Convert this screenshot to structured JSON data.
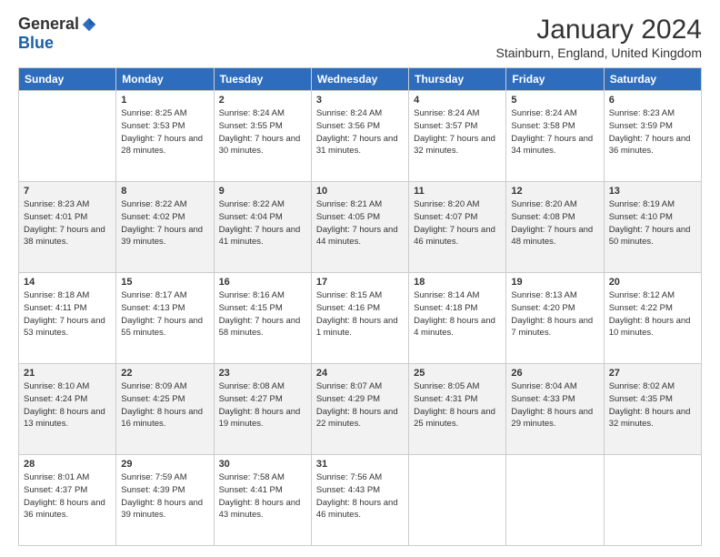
{
  "logo": {
    "general": "General",
    "blue": "Blue"
  },
  "title": "January 2024",
  "subtitle": "Stainburn, England, United Kingdom",
  "header_days": [
    "Sunday",
    "Monday",
    "Tuesday",
    "Wednesday",
    "Thursday",
    "Friday",
    "Saturday"
  ],
  "weeks": [
    [
      {
        "day": "",
        "sunrise": "",
        "sunset": "",
        "daylight": ""
      },
      {
        "day": "1",
        "sunrise": "Sunrise: 8:25 AM",
        "sunset": "Sunset: 3:53 PM",
        "daylight": "Daylight: 7 hours and 28 minutes."
      },
      {
        "day": "2",
        "sunrise": "Sunrise: 8:24 AM",
        "sunset": "Sunset: 3:55 PM",
        "daylight": "Daylight: 7 hours and 30 minutes."
      },
      {
        "day": "3",
        "sunrise": "Sunrise: 8:24 AM",
        "sunset": "Sunset: 3:56 PM",
        "daylight": "Daylight: 7 hours and 31 minutes."
      },
      {
        "day": "4",
        "sunrise": "Sunrise: 8:24 AM",
        "sunset": "Sunset: 3:57 PM",
        "daylight": "Daylight: 7 hours and 32 minutes."
      },
      {
        "day": "5",
        "sunrise": "Sunrise: 8:24 AM",
        "sunset": "Sunset: 3:58 PM",
        "daylight": "Daylight: 7 hours and 34 minutes."
      },
      {
        "day": "6",
        "sunrise": "Sunrise: 8:23 AM",
        "sunset": "Sunset: 3:59 PM",
        "daylight": "Daylight: 7 hours and 36 minutes."
      }
    ],
    [
      {
        "day": "7",
        "sunrise": "Sunrise: 8:23 AM",
        "sunset": "Sunset: 4:01 PM",
        "daylight": "Daylight: 7 hours and 38 minutes."
      },
      {
        "day": "8",
        "sunrise": "Sunrise: 8:22 AM",
        "sunset": "Sunset: 4:02 PM",
        "daylight": "Daylight: 7 hours and 39 minutes."
      },
      {
        "day": "9",
        "sunrise": "Sunrise: 8:22 AM",
        "sunset": "Sunset: 4:04 PM",
        "daylight": "Daylight: 7 hours and 41 minutes."
      },
      {
        "day": "10",
        "sunrise": "Sunrise: 8:21 AM",
        "sunset": "Sunset: 4:05 PM",
        "daylight": "Daylight: 7 hours and 44 minutes."
      },
      {
        "day": "11",
        "sunrise": "Sunrise: 8:20 AM",
        "sunset": "Sunset: 4:07 PM",
        "daylight": "Daylight: 7 hours and 46 minutes."
      },
      {
        "day": "12",
        "sunrise": "Sunrise: 8:20 AM",
        "sunset": "Sunset: 4:08 PM",
        "daylight": "Daylight: 7 hours and 48 minutes."
      },
      {
        "day": "13",
        "sunrise": "Sunrise: 8:19 AM",
        "sunset": "Sunset: 4:10 PM",
        "daylight": "Daylight: 7 hours and 50 minutes."
      }
    ],
    [
      {
        "day": "14",
        "sunrise": "Sunrise: 8:18 AM",
        "sunset": "Sunset: 4:11 PM",
        "daylight": "Daylight: 7 hours and 53 minutes."
      },
      {
        "day": "15",
        "sunrise": "Sunrise: 8:17 AM",
        "sunset": "Sunset: 4:13 PM",
        "daylight": "Daylight: 7 hours and 55 minutes."
      },
      {
        "day": "16",
        "sunrise": "Sunrise: 8:16 AM",
        "sunset": "Sunset: 4:15 PM",
        "daylight": "Daylight: 7 hours and 58 minutes."
      },
      {
        "day": "17",
        "sunrise": "Sunrise: 8:15 AM",
        "sunset": "Sunset: 4:16 PM",
        "daylight": "Daylight: 8 hours and 1 minute."
      },
      {
        "day": "18",
        "sunrise": "Sunrise: 8:14 AM",
        "sunset": "Sunset: 4:18 PM",
        "daylight": "Daylight: 8 hours and 4 minutes."
      },
      {
        "day": "19",
        "sunrise": "Sunrise: 8:13 AM",
        "sunset": "Sunset: 4:20 PM",
        "daylight": "Daylight: 8 hours and 7 minutes."
      },
      {
        "day": "20",
        "sunrise": "Sunrise: 8:12 AM",
        "sunset": "Sunset: 4:22 PM",
        "daylight": "Daylight: 8 hours and 10 minutes."
      }
    ],
    [
      {
        "day": "21",
        "sunrise": "Sunrise: 8:10 AM",
        "sunset": "Sunset: 4:24 PM",
        "daylight": "Daylight: 8 hours and 13 minutes."
      },
      {
        "day": "22",
        "sunrise": "Sunrise: 8:09 AM",
        "sunset": "Sunset: 4:25 PM",
        "daylight": "Daylight: 8 hours and 16 minutes."
      },
      {
        "day": "23",
        "sunrise": "Sunrise: 8:08 AM",
        "sunset": "Sunset: 4:27 PM",
        "daylight": "Daylight: 8 hours and 19 minutes."
      },
      {
        "day": "24",
        "sunrise": "Sunrise: 8:07 AM",
        "sunset": "Sunset: 4:29 PM",
        "daylight": "Daylight: 8 hours and 22 minutes."
      },
      {
        "day": "25",
        "sunrise": "Sunrise: 8:05 AM",
        "sunset": "Sunset: 4:31 PM",
        "daylight": "Daylight: 8 hours and 25 minutes."
      },
      {
        "day": "26",
        "sunrise": "Sunrise: 8:04 AM",
        "sunset": "Sunset: 4:33 PM",
        "daylight": "Daylight: 8 hours and 29 minutes."
      },
      {
        "day": "27",
        "sunrise": "Sunrise: 8:02 AM",
        "sunset": "Sunset: 4:35 PM",
        "daylight": "Daylight: 8 hours and 32 minutes."
      }
    ],
    [
      {
        "day": "28",
        "sunrise": "Sunrise: 8:01 AM",
        "sunset": "Sunset: 4:37 PM",
        "daylight": "Daylight: 8 hours and 36 minutes."
      },
      {
        "day": "29",
        "sunrise": "Sunrise: 7:59 AM",
        "sunset": "Sunset: 4:39 PM",
        "daylight": "Daylight: 8 hours and 39 minutes."
      },
      {
        "day": "30",
        "sunrise": "Sunrise: 7:58 AM",
        "sunset": "Sunset: 4:41 PM",
        "daylight": "Daylight: 8 hours and 43 minutes."
      },
      {
        "day": "31",
        "sunrise": "Sunrise: 7:56 AM",
        "sunset": "Sunset: 4:43 PM",
        "daylight": "Daylight: 8 hours and 46 minutes."
      },
      {
        "day": "",
        "sunrise": "",
        "sunset": "",
        "daylight": ""
      },
      {
        "day": "",
        "sunrise": "",
        "sunset": "",
        "daylight": ""
      },
      {
        "day": "",
        "sunrise": "",
        "sunset": "",
        "daylight": ""
      }
    ]
  ]
}
